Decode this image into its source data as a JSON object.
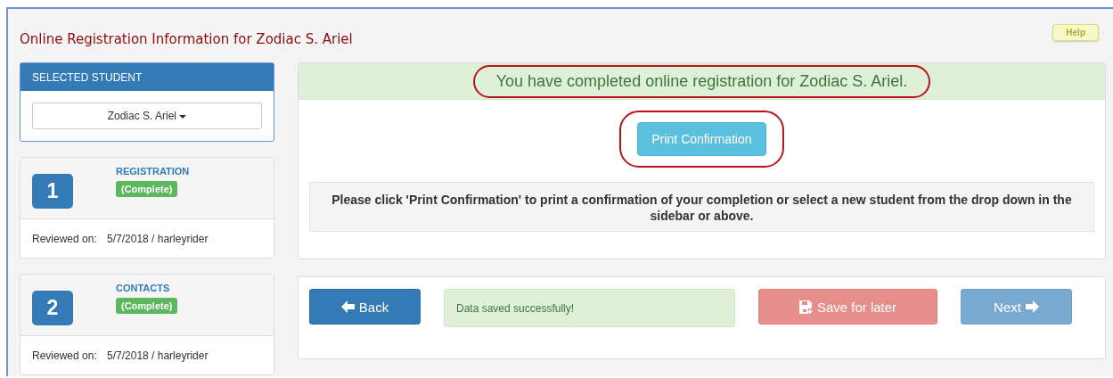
{
  "page_title": "Online Registration Information for Zodiac S. Ariel",
  "help_button": "Help",
  "sidebar": {
    "header": "SELECTED STUDENT",
    "student_dropdown": "Zodiac S. Ariel",
    "steps": [
      {
        "number": "1",
        "title": "REGISTRATION",
        "status": "(Complete)",
        "reviewed_label": "Reviewed on:",
        "reviewed_value": "5/7/2018 / harleyrider"
      },
      {
        "number": "2",
        "title": "CONTACTS",
        "status": "(Complete)",
        "reviewed_label": "Reviewed on:",
        "reviewed_value": "5/7/2018 / harleyrider"
      }
    ]
  },
  "main": {
    "banner": "You have completed online registration for Zodiac S. Ariel.",
    "banner_highlighted": true,
    "print_button": "Print Confirmation",
    "print_highlighted": true,
    "instructions": "Please click 'Print Confirmation' to print a confirmation of your completion or select a new student from the drop down in the sidebar or above."
  },
  "footer": {
    "buttons": [
      {
        "kind": "back",
        "label": "Back",
        "disabled": false
      },
      {
        "kind": "message",
        "label": "Data saved successfully!"
      },
      {
        "kind": "save",
        "label": "Save for later",
        "disabled": true
      },
      {
        "kind": "next",
        "label": "Next",
        "disabled": true
      }
    ]
  }
}
